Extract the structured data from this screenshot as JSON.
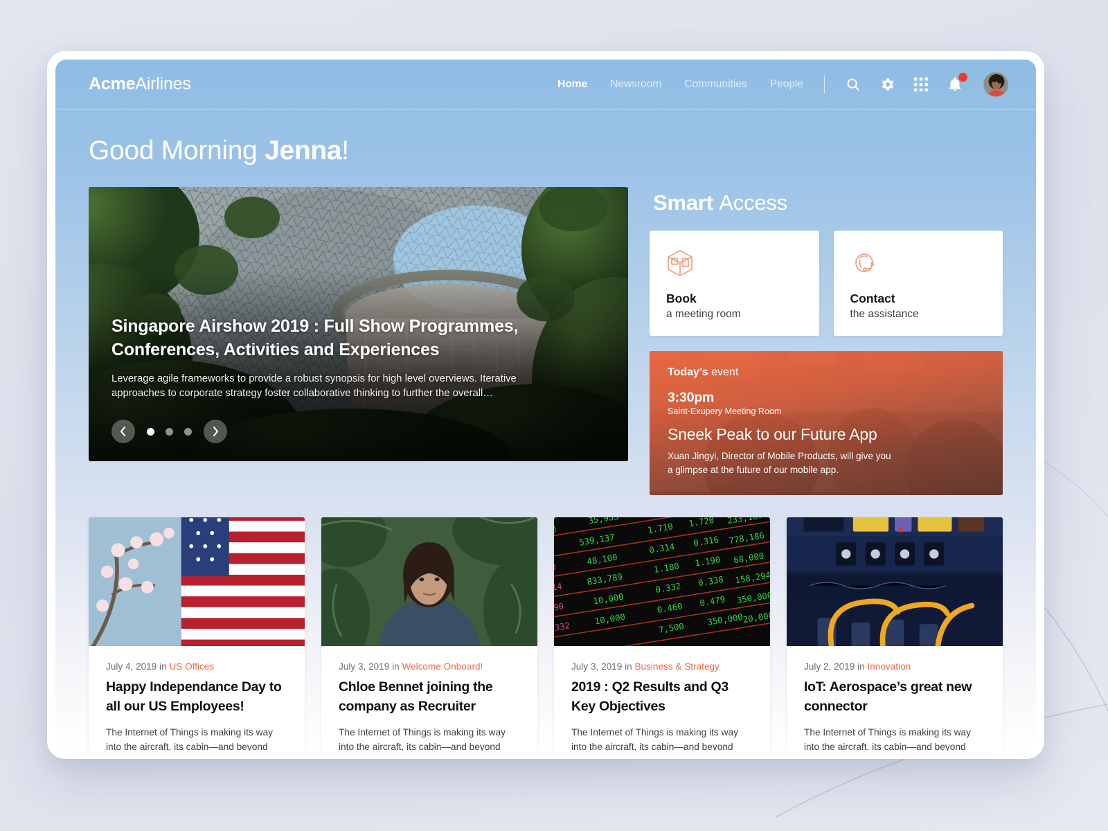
{
  "brand": {
    "bold": "Acme",
    "light": "Airlines"
  },
  "nav": {
    "links": [
      {
        "label": "Home",
        "active": true
      },
      {
        "label": "Newsroom",
        "active": false
      },
      {
        "label": "Communities",
        "active": false
      },
      {
        "label": "People",
        "active": false
      }
    ],
    "icons": [
      "search-icon",
      "gear-icon",
      "apps-grid-icon",
      "notification-bell-icon"
    ],
    "notification_badge": true
  },
  "greeting": {
    "light": "Good Morning ",
    "bold": "Jenna",
    "suffix": "!"
  },
  "hero": {
    "title": "Singapore Airshow 2019 : Full Show Programmes, Conferences, Activities and Experiences",
    "description": "Leverage agile frameworks to provide a robust synopsis for high level overviews. Iterative approaches to corporate strategy foster collaborative thinking to further the overall…",
    "prev_label": "‹",
    "next_label": "›",
    "slides": 3,
    "active_slide": 1
  },
  "smart_access": {
    "title_bold": "Smart ",
    "title_light": "Access",
    "tiles": [
      {
        "icon": "meeting-room-icon",
        "strong": "Book",
        "sub": "a meeting room"
      },
      {
        "icon": "headset-support-icon",
        "strong": "Contact",
        "sub": "the assistance"
      }
    ]
  },
  "event": {
    "kicker_bold": "Today’s ",
    "kicker_light": "event",
    "time": "3:30pm",
    "room": "Saint-Exupery Meeting Room",
    "title": "Sneek Peak to our Future App",
    "description": "Xuan Jingyi, Director of Mobile Products, will give you a glimpse at the future of our mobile app."
  },
  "news": [
    {
      "date": "July 4, 2019 in ",
      "category": "US Offices",
      "title": "Happy Independance Day to all our US Employees!",
      "excerpt": "The Internet of Things is making its way into the aircraft, its cabin—and beyond",
      "image": "us-flag-cherry-blossom-photo"
    },
    {
      "date": "July 3, 2019 in ",
      "category": "Welcome Onboard!",
      "title": "Chloe Bennet joining the company as Recruiter",
      "excerpt": "The Internet of Things is making its way into the aircraft, its cabin—and beyond",
      "image": "portrait-woman-photo"
    },
    {
      "date": "July 3, 2019 in ",
      "category": "Business & Strategy",
      "title": "2019 : Q2 Results and Q3 Key Objectives",
      "excerpt": "The Internet of Things is making its way into the aircraft, its cabin—and beyond",
      "image": "stock-ticker-board-photo"
    },
    {
      "date": "July 2, 2019 in ",
      "category": "Innovation",
      "title": "IoT: Aerospace’s great new connector",
      "excerpt": "The Internet of Things is making its way into the aircraft, its cabin—and beyond",
      "image": "network-cables-photo"
    }
  ],
  "colors": {
    "accent": "#f26a4b",
    "brand_blue": "#8fbce4",
    "badge_red": "#ef3b2f",
    "event_orange": "#f3683f"
  }
}
